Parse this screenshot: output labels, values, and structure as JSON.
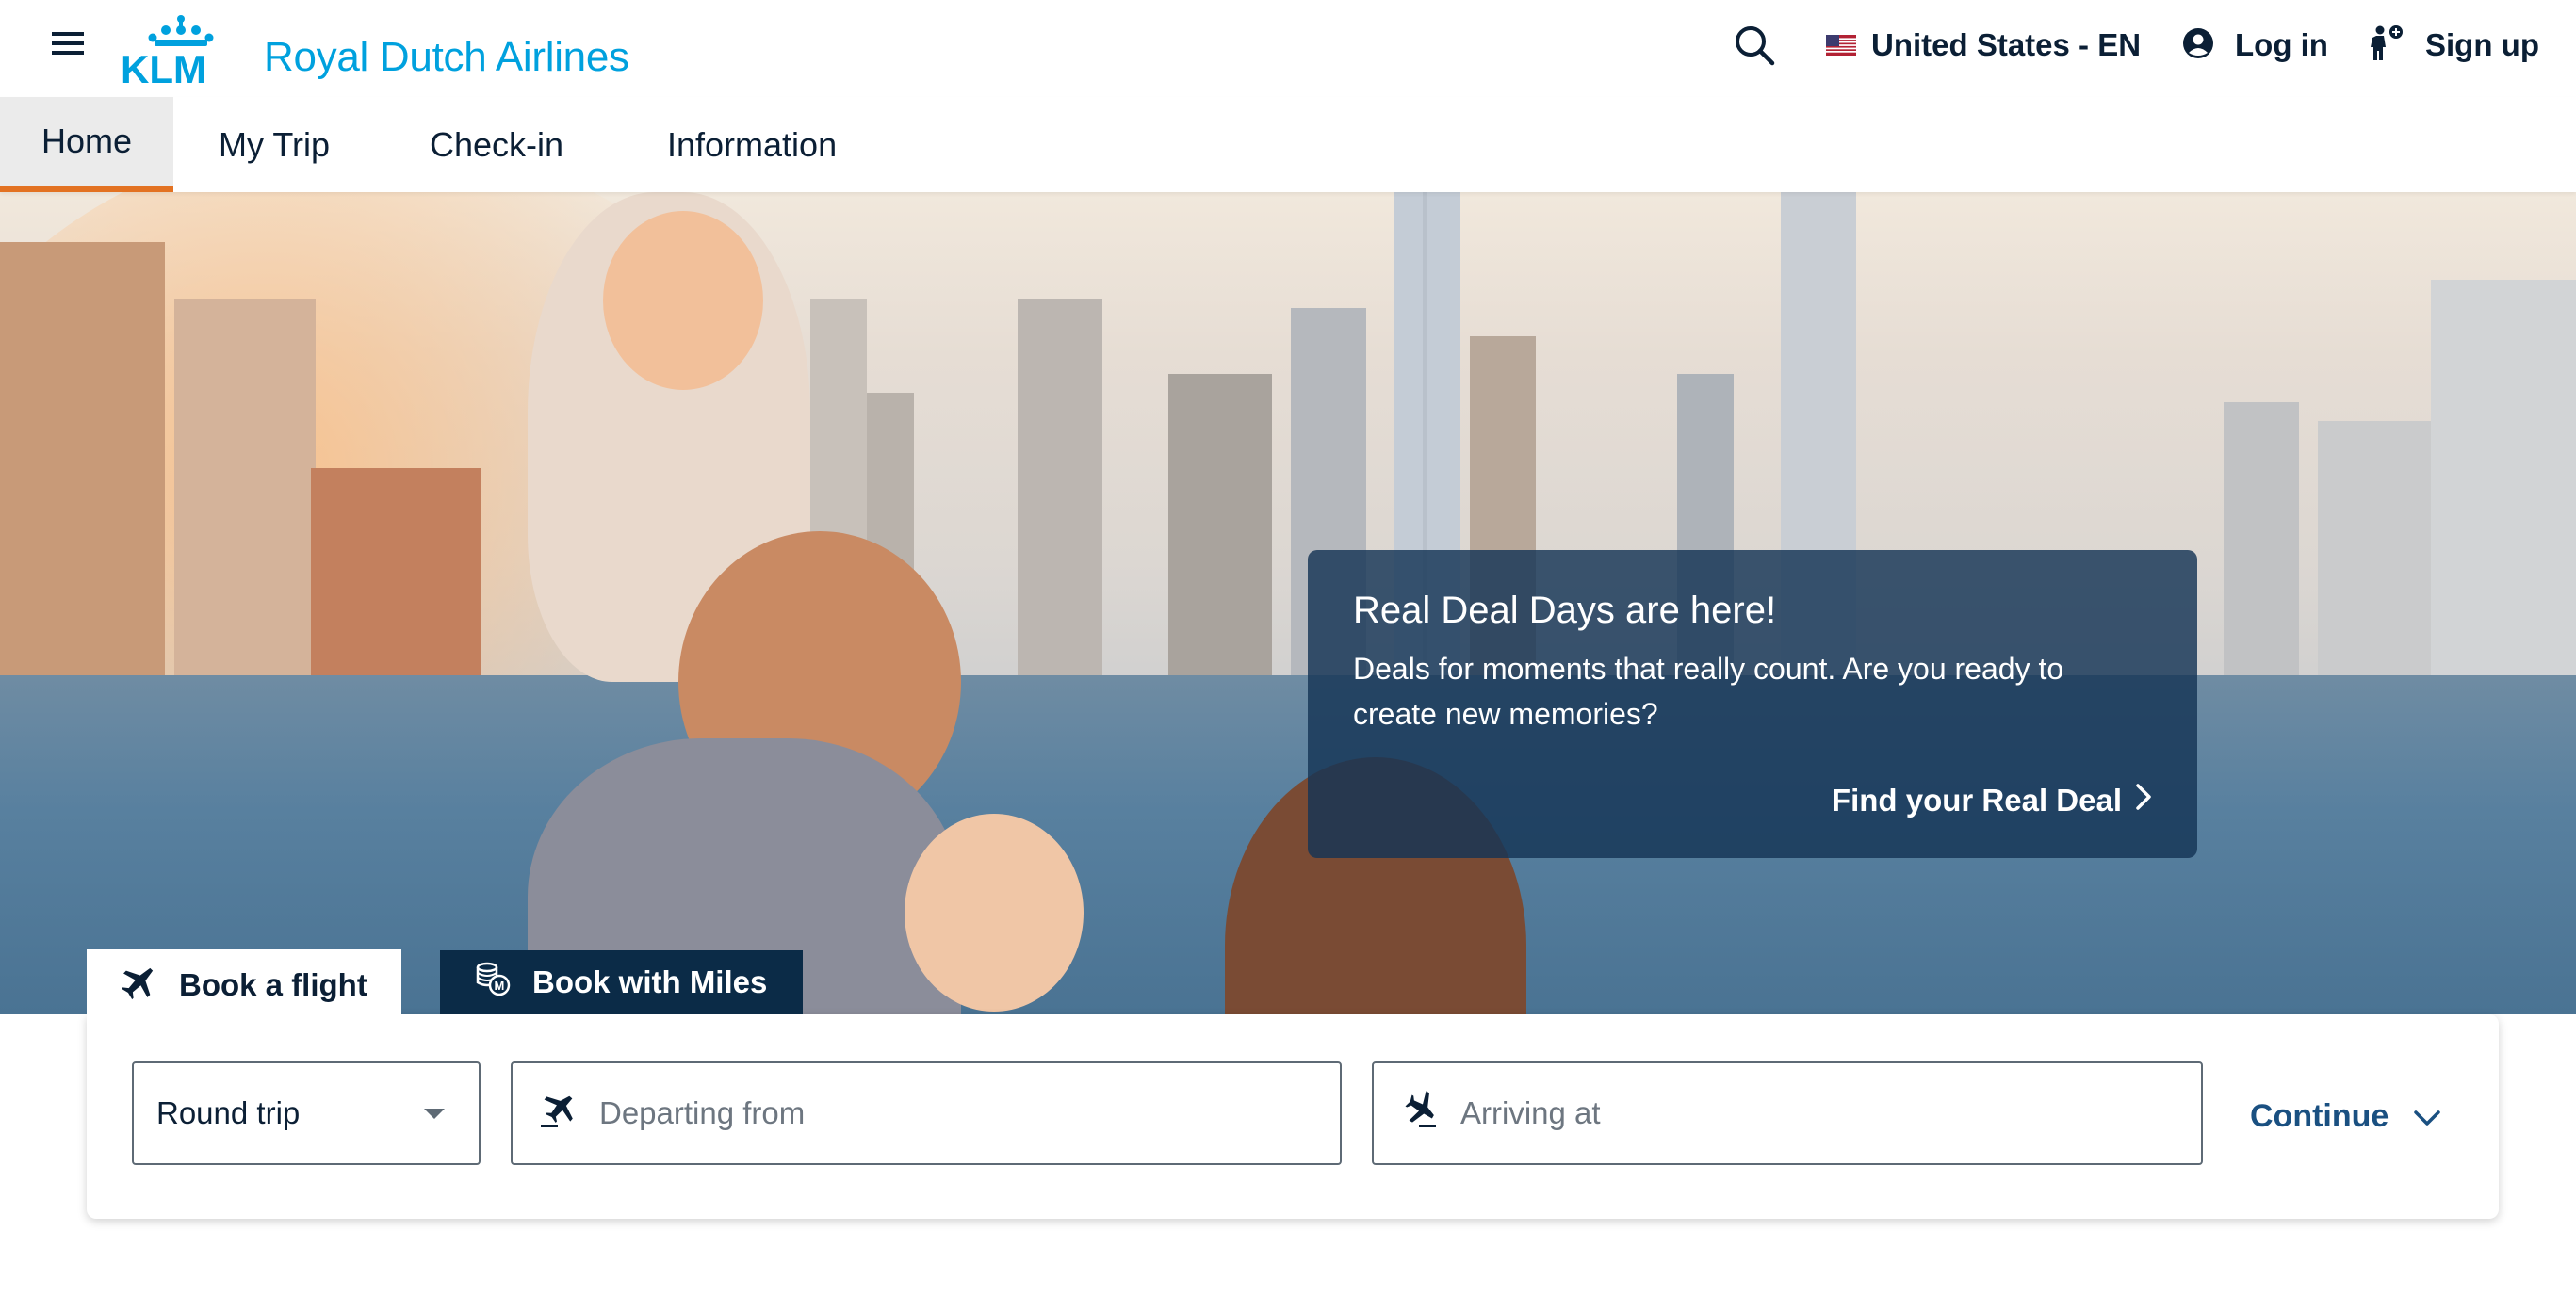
{
  "header": {
    "logo_text": "KLM",
    "tagline": "Royal Dutch Airlines",
    "locale_label": "United States - EN",
    "login_label": "Log in",
    "signup_label": "Sign up",
    "icons": {
      "menu": "hamburger-icon",
      "search": "search-icon",
      "flag": "us-flag-icon",
      "user": "user-circle-icon",
      "signup": "person-plus-icon"
    }
  },
  "nav": {
    "tabs": [
      {
        "label": "Home",
        "active": true
      },
      {
        "label": "My Trip",
        "active": false
      },
      {
        "label": "Check-in",
        "active": false
      },
      {
        "label": "Information",
        "active": false
      }
    ]
  },
  "promo": {
    "title": "Real Deal Days are here!",
    "body": "Deals for moments that really count. Are you ready to create new memories?",
    "link_label": "Find your Real Deal"
  },
  "booking": {
    "tabs": [
      {
        "label": "Book a flight",
        "icon": "airplane-icon",
        "active": true
      },
      {
        "label": "Book with Miles",
        "icon": "miles-coins-icon",
        "active": false
      }
    ],
    "trip_type": "Round trip",
    "from_placeholder": "Departing from",
    "to_placeholder": "Arriving at",
    "continue_label": "Continue"
  },
  "colors": {
    "brand_blue": "#00a1de",
    "navy": "#0b1f35",
    "active_tab_underline": "#e37222",
    "link_blue": "#1a5081"
  }
}
